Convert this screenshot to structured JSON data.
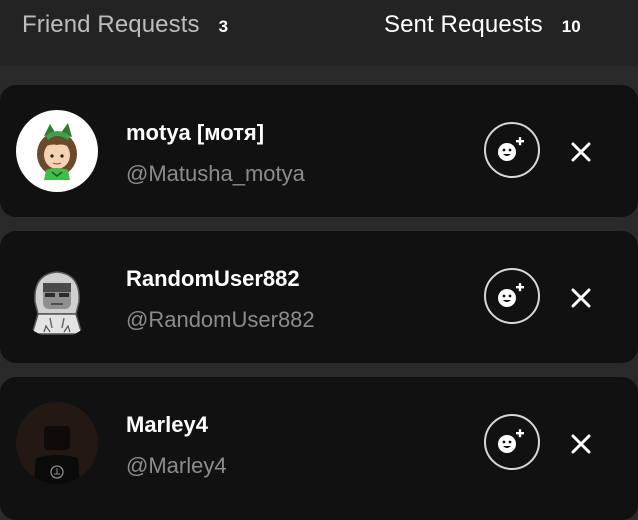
{
  "tabs": {
    "friend_requests": {
      "label": "Friend Requests",
      "count": "3"
    },
    "sent_requests": {
      "label": "Sent Requests",
      "count": "10"
    }
  },
  "requests": [
    {
      "display_name": "motya [мотя]",
      "username": "@Matusha_motya",
      "avatar_icon": "avatar-brown-hair-green-accessory-icon"
    },
    {
      "display_name": "RandomUser882",
      "username": "@RandomUser882",
      "avatar_icon": "avatar-gray-hoodie-icon"
    },
    {
      "display_name": "Marley4",
      "username": "@Marley4",
      "avatar_icon": "avatar-dark-hoodie-icon"
    }
  ],
  "actions": {
    "accept_icon": "add-friend-smiley-icon",
    "decline_icon": "close-icon"
  },
  "colors": {
    "page_bg": "#2a2a2a",
    "header_bg": "#232323",
    "card_bg": "#111111",
    "primary_text": "#ffffff",
    "secondary_text": "#8c8c8c",
    "inactive_tab_text": "#bdbdbd",
    "button_outline": "#d8d8d8"
  }
}
